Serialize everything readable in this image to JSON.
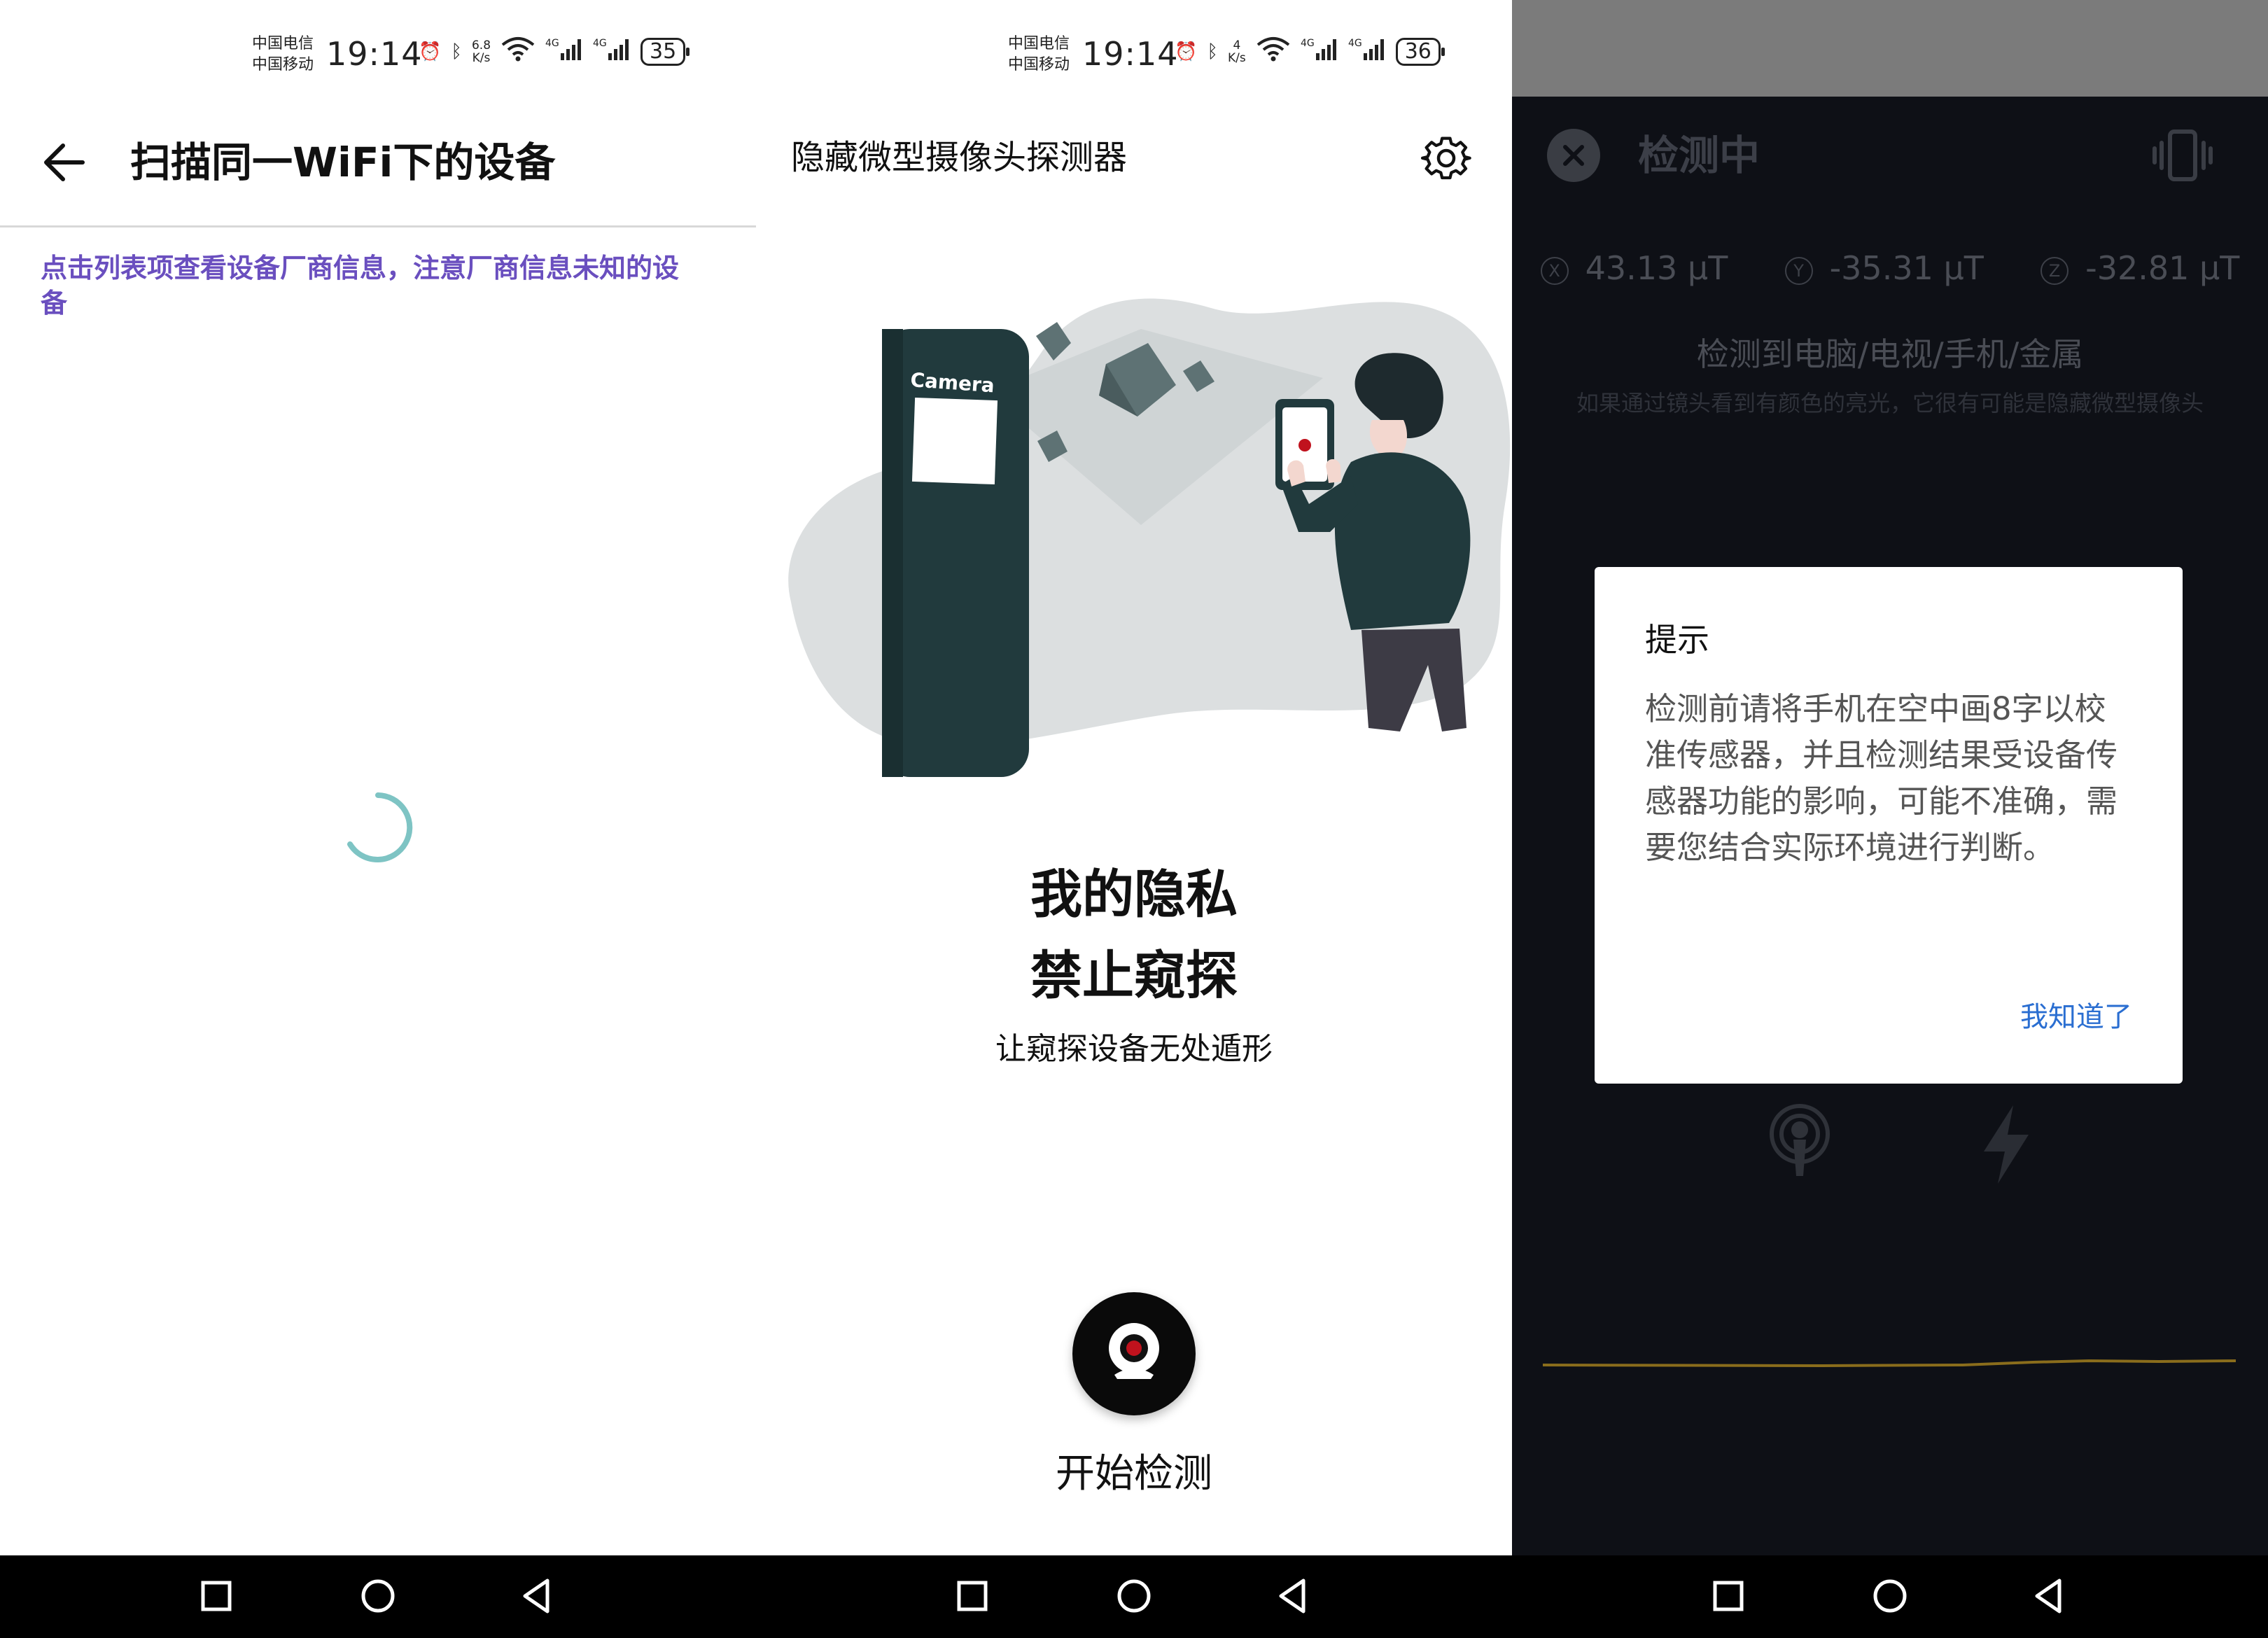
{
  "status_bars": [
    {
      "carrier_top": "中国电信",
      "carrier_bottom": "中国移动",
      "time": "19:14",
      "speed_top": "6.8",
      "speed_bottom": "K/s",
      "battery": "35"
    },
    {
      "carrier_top": "中国电信",
      "carrier_bottom": "中国移动",
      "time": "19:14",
      "speed_top": "4",
      "speed_bottom": "K/s",
      "battery": "36"
    }
  ],
  "wifi_scan": {
    "title": "扫描同一WiFi下的设备",
    "notice": "点击列表项查看设备厂商信息，注意厂商信息未知的设备",
    "spinner_color": "#7ec4c4"
  },
  "detector_home": {
    "title": "隐藏微型摄像头探测器",
    "camera_sign": "Camera",
    "slogan_line1": "我的隐私",
    "slogan_line2": "禁止窥探",
    "subtitle": "让窥探设备无处遁形",
    "start_label": "开始检测",
    "accent_red": "#c0121d"
  },
  "detecting": {
    "title": "检测中",
    "readings": [
      {
        "axis": "X",
        "value": "43.13 µT"
      },
      {
        "axis": "Y",
        "value": "-35.31 µT"
      },
      {
        "axis": "Z",
        "value": "-32.81 µT"
      }
    ],
    "detected": "检测到电脑/电视/手机/金属",
    "hint": "如果通过镜头看到有颜色的亮光，它很有可能是隐藏微型摄像头",
    "dialog": {
      "title": "提示",
      "body": "检测前请将手机在空中画8字以校准传感器，并且检测结果受设备传感器功能的影响，可能不准确，需要您结合实际环境进行判断。",
      "button": "我知道了"
    },
    "graph_color": "#8a6d1c"
  },
  "nav_icons": [
    "square-icon",
    "circle-icon",
    "back-triangle-icon"
  ]
}
